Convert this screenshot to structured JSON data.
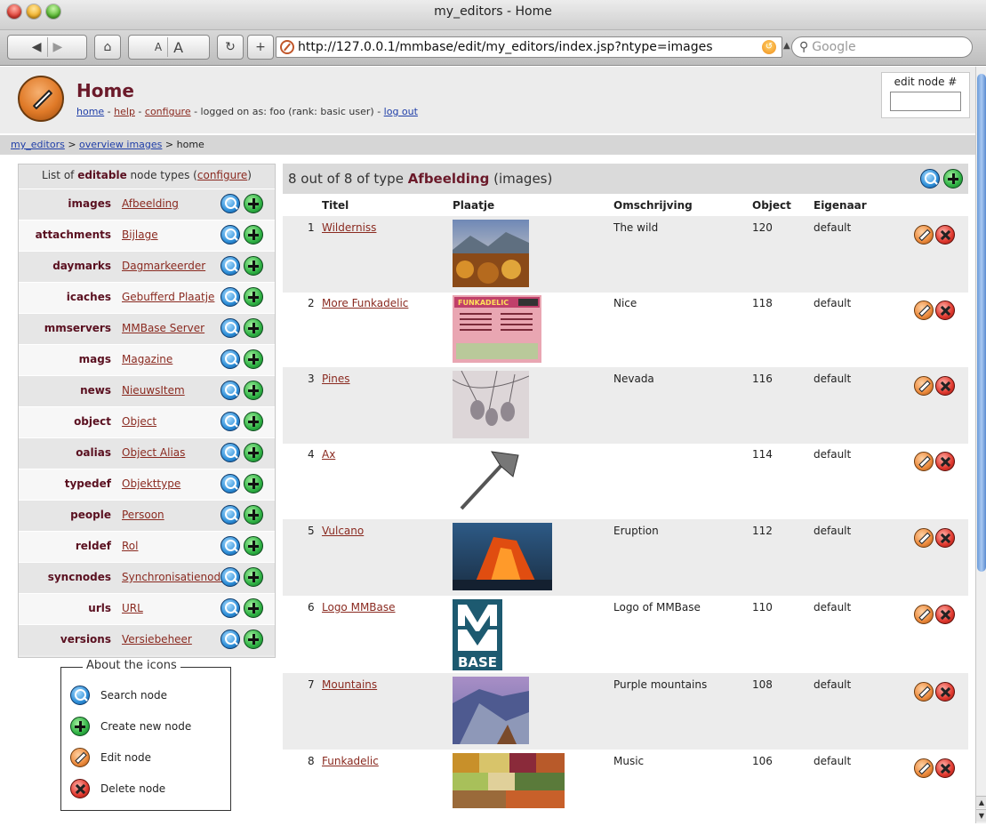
{
  "window": {
    "title": "my_editors - Home",
    "url": "http://127.0.0.1/mmbase/edit/my_editors/index.jsp?ntype=images",
    "search_placeholder": "Google",
    "font_small": "A",
    "font_large": "A"
  },
  "header": {
    "title": "Home",
    "links": {
      "home": "home",
      "sep1": " - ",
      "help": "help",
      "sep2": " - ",
      "configure": "configure",
      "status": " - logged on as: foo (rank: basic user) - ",
      "logout": "log out"
    },
    "edit_node_label": "edit node #"
  },
  "breadcrumb": {
    "root": "my_editors",
    "sep1": " > ",
    "overview": "overview images",
    "sep2": " > ",
    "current": "home"
  },
  "sidebar": {
    "head_prefix": "List of ",
    "head_bold": "editable",
    "head_mid": " node types (",
    "head_link": "configure",
    "head_suffix": ")",
    "items": [
      {
        "key": "images",
        "label": "Afbeelding",
        "blue": true
      },
      {
        "key": "attachments",
        "label": "Bijlage",
        "blue": false
      },
      {
        "key": "daymarks",
        "label": "Dagmarkeerder",
        "blue": false
      },
      {
        "key": "icaches",
        "label": "Gebufferd Plaatje",
        "blue": false
      },
      {
        "key": "mmservers",
        "label": "MMBase Server",
        "blue": false
      },
      {
        "key": "mags",
        "label": "Magazine",
        "blue": false
      },
      {
        "key": "news",
        "label": "NieuwsItem",
        "blue": true
      },
      {
        "key": "object",
        "label": "Object",
        "blue": false
      },
      {
        "key": "oalias",
        "label": "Object Alias",
        "blue": false
      },
      {
        "key": "typedef",
        "label": "Objekttype",
        "blue": false
      },
      {
        "key": "people",
        "label": "Persoon",
        "blue": false
      },
      {
        "key": "reldef",
        "label": "Rol",
        "blue": false
      },
      {
        "key": "syncnodes",
        "label": "Synchronisatienode",
        "blue": false
      },
      {
        "key": "urls",
        "label": "URL",
        "blue": false
      },
      {
        "key": "versions",
        "label": "Versiebeheer",
        "blue": false
      }
    ]
  },
  "legend": {
    "title": "About the icons",
    "items": [
      {
        "icon": "search-icon",
        "label": "Search node"
      },
      {
        "icon": "add-icon",
        "label": "Create new node"
      },
      {
        "icon": "edit-icon",
        "label": "Edit node"
      },
      {
        "icon": "delete-icon",
        "label": "Delete node"
      }
    ]
  },
  "main": {
    "head_count": "8 out of 8 of type ",
    "head_type": "Afbeelding",
    "head_suffix": " (images)",
    "columns": [
      "Titel",
      "Plaatje",
      "Omschrijving",
      "Object",
      "Eigenaar"
    ],
    "rows": [
      {
        "num": "1",
        "title": "Wilderniss",
        "desc": "The wild",
        "object": "120",
        "owner": "default",
        "thumb": "wilderness"
      },
      {
        "num": "2",
        "title": "More Funkadelic",
        "desc": "Nice",
        "object": "118",
        "owner": "default",
        "thumb": "funkadelic-back"
      },
      {
        "num": "3",
        "title": "Pines",
        "desc": "Nevada",
        "object": "116",
        "owner": "default",
        "thumb": "pines"
      },
      {
        "num": "4",
        "title": "Ax",
        "desc": "",
        "object": "114",
        "owner": "default",
        "thumb": "axe"
      },
      {
        "num": "5",
        "title": "Vulcano",
        "desc": "Eruption",
        "object": "112",
        "owner": "default",
        "thumb": "volcano"
      },
      {
        "num": "6",
        "title": "Logo MMBase",
        "desc": "Logo of MMBase",
        "object": "110",
        "owner": "default",
        "thumb": "mmbase-logo"
      },
      {
        "num": "7",
        "title": "Mountains",
        "desc": "Purple mountains",
        "object": "108",
        "owner": "default",
        "thumb": "mountains"
      },
      {
        "num": "8",
        "title": "Funkadelic",
        "desc": "Music",
        "object": "106",
        "owner": "default",
        "thumb": "funkadelic-front"
      }
    ]
  },
  "mmbase_logo_text": "BASE"
}
